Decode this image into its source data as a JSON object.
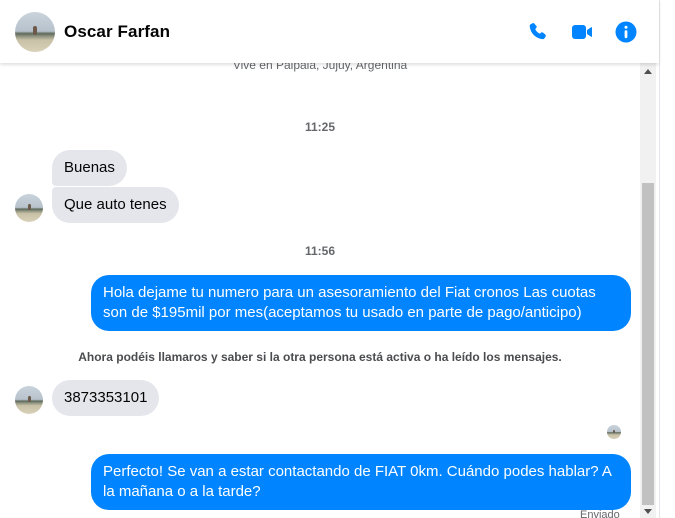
{
  "header": {
    "contact_name": "Oscar Farfan",
    "icons": [
      "phone-icon",
      "video-camera-icon",
      "info-icon"
    ],
    "accent_color": "#0084ff"
  },
  "conversation": {
    "profile_location": "Vive en Palpalá, Jujuy, Argentina",
    "timestamps": [
      "11:25",
      "11:56"
    ],
    "messages": [
      {
        "direction": "incoming",
        "text": "Buenas"
      },
      {
        "direction": "incoming",
        "text": "Que auto tenes"
      },
      {
        "direction": "outgoing",
        "text": "Hola dejame tu numero para un asesoramiento del Fiat cronos Las cuotas son de $195mil por mes(aceptamos tu usado en parte de pago/anticipo)"
      },
      {
        "direction": "incoming",
        "text": "3873353101"
      },
      {
        "direction": "outgoing",
        "text": "Perfecto!  Se van a estar contactando de FIAT 0km. Cuándo podes hablar? A la mañana o a la tarde?"
      }
    ],
    "notice": "Ahora podéis llamaros y saber si la otra persona está activa o ha leído los mensajes.",
    "sent_status": "Enviado"
  },
  "colors": {
    "incoming_bubble": "#e4e6eb",
    "outgoing_bubble": "#0084ff",
    "secondary_text": "#65676b"
  }
}
